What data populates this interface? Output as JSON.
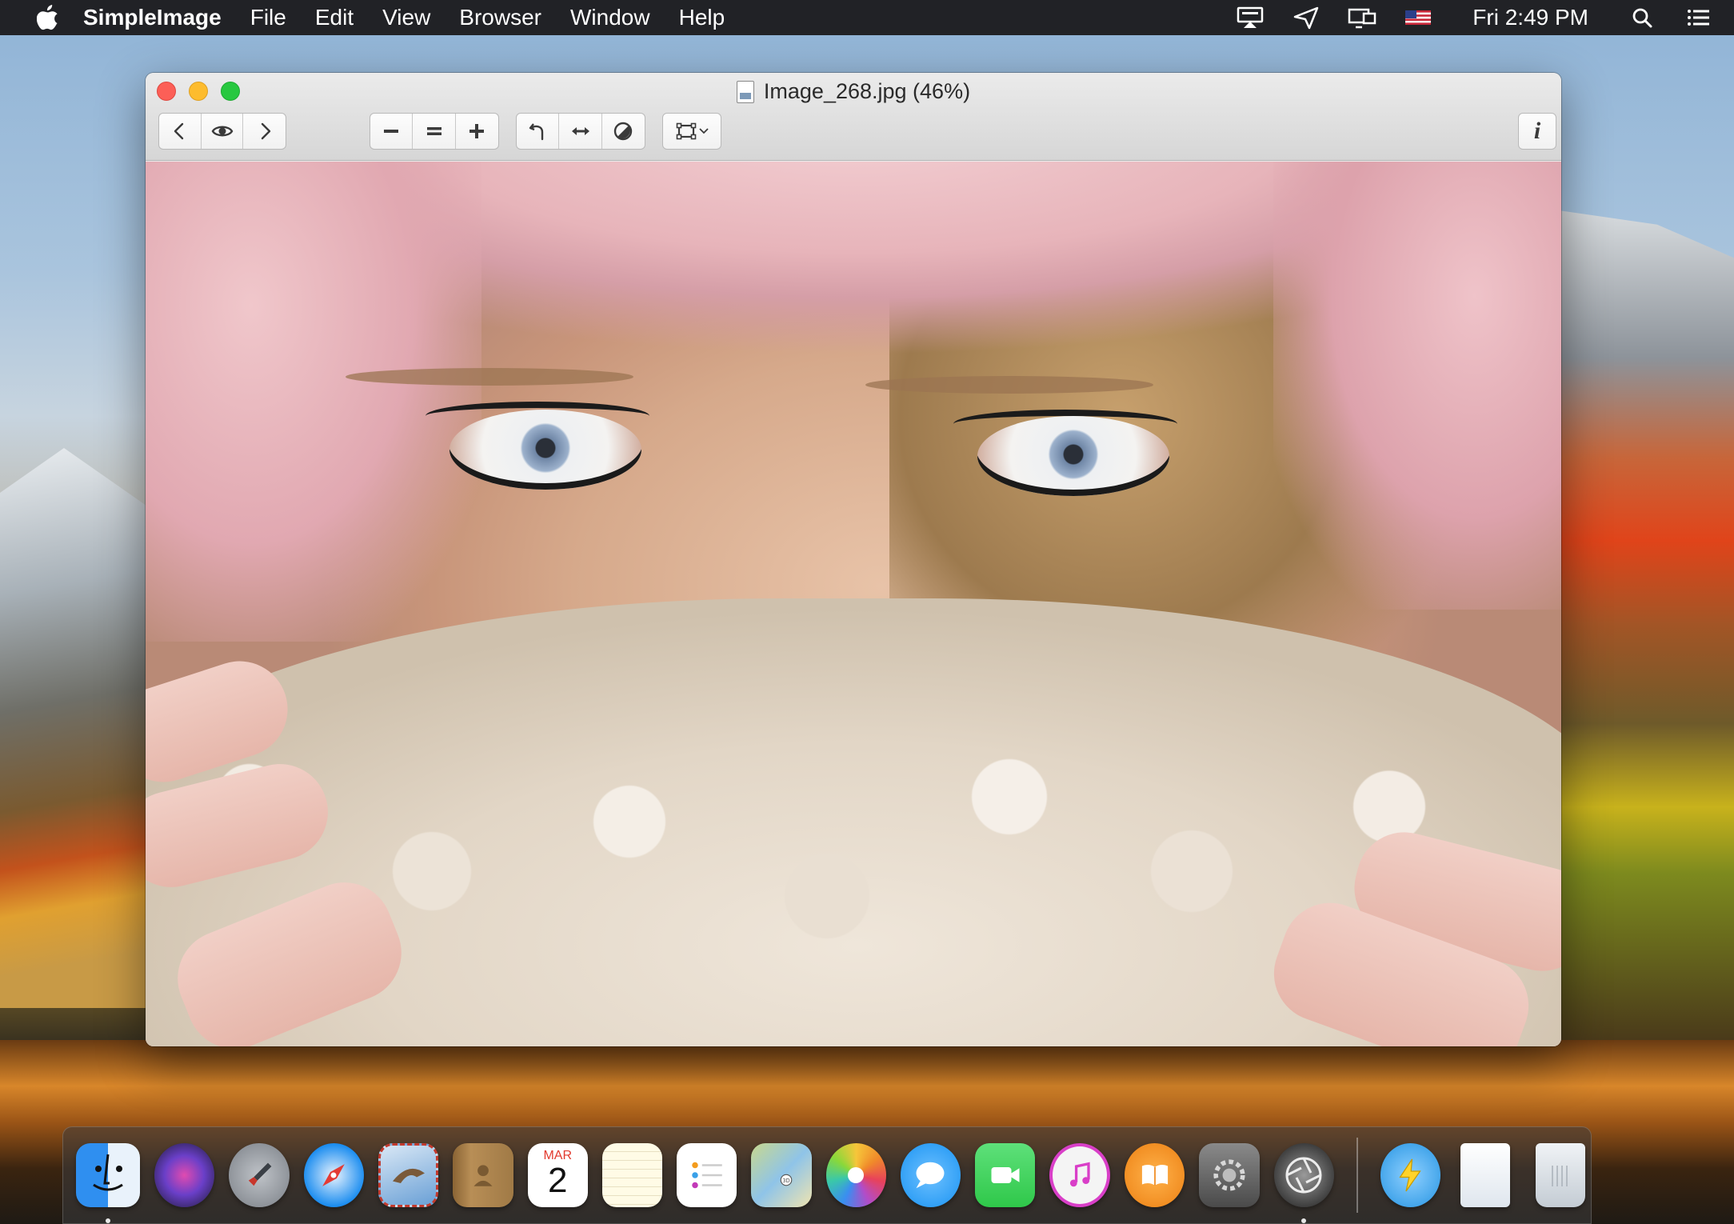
{
  "menubar": {
    "app_name": "SimpleImage",
    "items": [
      "File",
      "Edit",
      "View",
      "Browser",
      "Window",
      "Help"
    ],
    "clock": "Fri 2:49 PM",
    "status_icons": [
      "display-mirroring-icon",
      "send-icon",
      "displays-icon",
      "us-flag-input-icon",
      "spotlight-search-icon",
      "notification-center-icon"
    ]
  },
  "window": {
    "title": "Image_268.jpg (46%)",
    "toolbar": {
      "navigation": [
        "previous-icon",
        "preview-eye-icon",
        "next-icon"
      ],
      "zoom": [
        "zoom-out-icon",
        "actual-size-icon",
        "zoom-in-icon"
      ],
      "adjust": [
        "rotate-left-icon",
        "flip-horizontal-icon",
        "color-adjust-icon"
      ],
      "crop": [
        "crop-icon",
        "chevron-down-icon"
      ],
      "info_label": "i"
    }
  },
  "dock": {
    "apps": [
      {
        "name": "Finder",
        "icon": "finder-icon",
        "color": "#2f8ff0",
        "running": true
      },
      {
        "name": "Siri",
        "icon": "siri-icon",
        "color": "#3b2a6e",
        "running": false
      },
      {
        "name": "Launchpad",
        "icon": "launchpad-icon",
        "color": "#7a7f86",
        "running": false
      },
      {
        "name": "Safari",
        "icon": "safari-icon",
        "color": "#1d8ef0",
        "running": false
      },
      {
        "name": "Mail",
        "icon": "mail-icon",
        "color": "#6aa0d6",
        "running": false
      },
      {
        "name": "Contacts",
        "icon": "contacts-icon",
        "color": "#a07a46",
        "running": false
      },
      {
        "name": "Calendar",
        "icon": "calendar-icon",
        "color": "#ffffff",
        "month": "MAR",
        "day": "2",
        "running": false
      },
      {
        "name": "Notes",
        "icon": "notes-icon",
        "color": "#f8e27a",
        "running": false
      },
      {
        "name": "Reminders",
        "icon": "reminders-icon",
        "color": "#ffffff",
        "running": false
      },
      {
        "name": "Maps",
        "icon": "maps-icon",
        "color": "#c8d88e",
        "running": false
      },
      {
        "name": "Photos",
        "icon": "photos-icon",
        "color": "#ffffff",
        "running": false
      },
      {
        "name": "Messages",
        "icon": "messages-icon",
        "color": "#2a9cf5",
        "running": false
      },
      {
        "name": "FaceTime",
        "icon": "facetime-icon",
        "color": "#2fc84a",
        "running": false
      },
      {
        "name": "iTunes",
        "icon": "itunes-icon",
        "color": "#f0f0f0",
        "running": false
      },
      {
        "name": "iBooks",
        "icon": "ibooks-icon",
        "color": "#f08a1e",
        "running": false
      },
      {
        "name": "System Preferences",
        "icon": "system-preferences-icon",
        "color": "#6b6b6b",
        "running": false
      },
      {
        "name": "SimpleImage",
        "icon": "simpleimage-aperture-icon",
        "color": "#3a3a3a",
        "running": true
      }
    ],
    "others": [
      {
        "name": "Downloads",
        "icon": "thunder-globe-icon",
        "color": "#3aa0e8"
      },
      {
        "name": "Documents",
        "icon": "document-stack-icon",
        "color": "#f4f6f8"
      },
      {
        "name": "Trash",
        "icon": "trash-icon",
        "color": "#d8dde2"
      }
    ]
  }
}
